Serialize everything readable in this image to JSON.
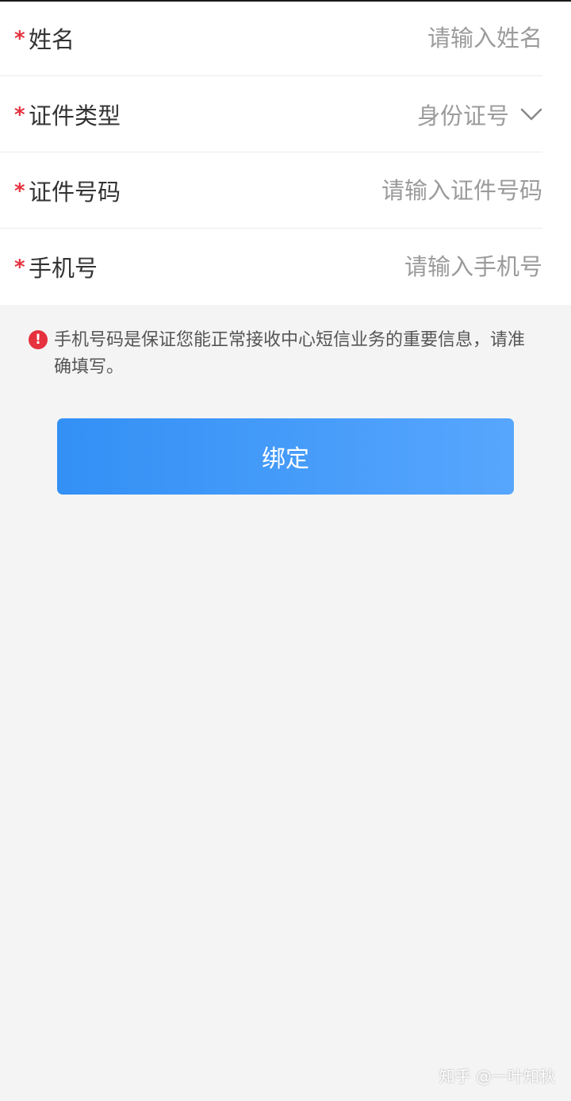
{
  "form": {
    "required_mark": "*",
    "name": {
      "label": "姓名",
      "placeholder": "请输入姓名",
      "value": ""
    },
    "id_type": {
      "label": "证件类型",
      "selected": "身份证号",
      "icon": "chevron-down-icon"
    },
    "id_number": {
      "label": "证件号码",
      "placeholder": "请输入证件号码",
      "value": ""
    },
    "phone": {
      "label": "手机号",
      "placeholder": "请输入手机号",
      "value": ""
    }
  },
  "tip": {
    "icon": "warning-icon",
    "icon_glyph": "!",
    "text": "手机号码是保证您能正常接收中心短信业务的重要信息，请准确填写。"
  },
  "actions": {
    "bind_label": "绑定"
  },
  "watermark": {
    "text": "知乎 @一叶知秋"
  },
  "colors": {
    "accent_start": "#3390f5",
    "accent_end": "#57a6fd",
    "required": "#e5323e",
    "background": "#f4f4f4"
  }
}
